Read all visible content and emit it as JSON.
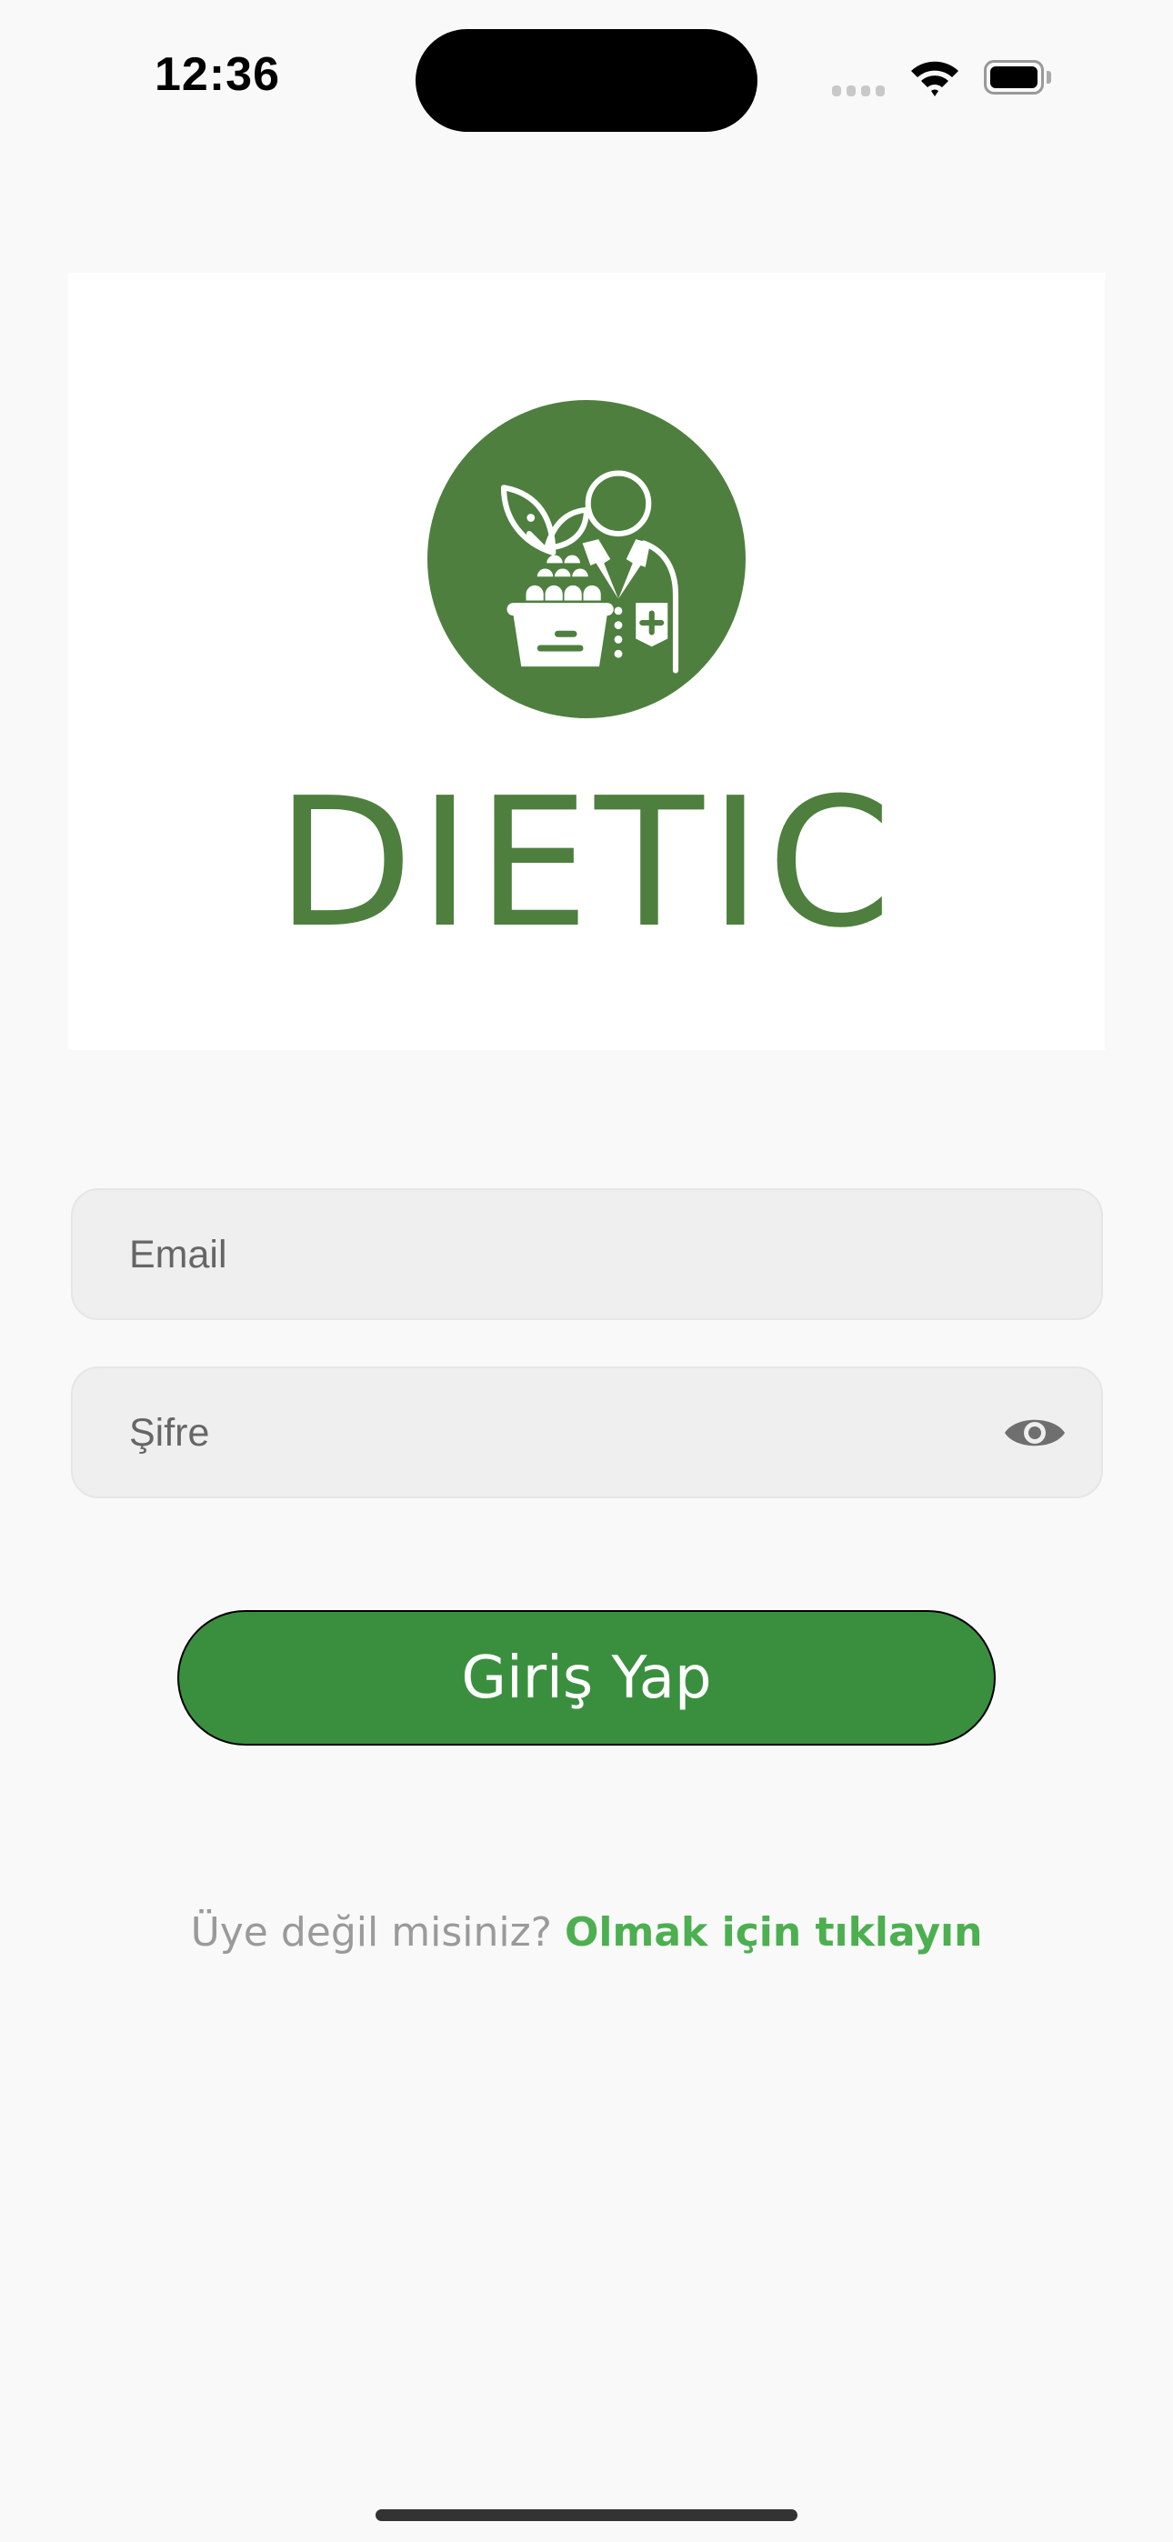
{
  "status_bar": {
    "time": "12:36",
    "icons": [
      "signal-icon",
      "wifi-icon",
      "battery-icon"
    ]
  },
  "logo": {
    "brand_name": "DIETIC",
    "icon": "dietitian-icon",
    "brand_color": "#4e7f3e"
  },
  "form": {
    "email": {
      "placeholder": "Email",
      "value": ""
    },
    "password": {
      "placeholder": "Şifre",
      "value": "",
      "toggle_icon": "eye-icon"
    },
    "login_label": "Giriş Yap",
    "login_color": "#3a8f3f"
  },
  "signup": {
    "question": "Üye değil misiniz?",
    "link": "Olmak için tıklayın",
    "link_color": "#4caf50"
  }
}
